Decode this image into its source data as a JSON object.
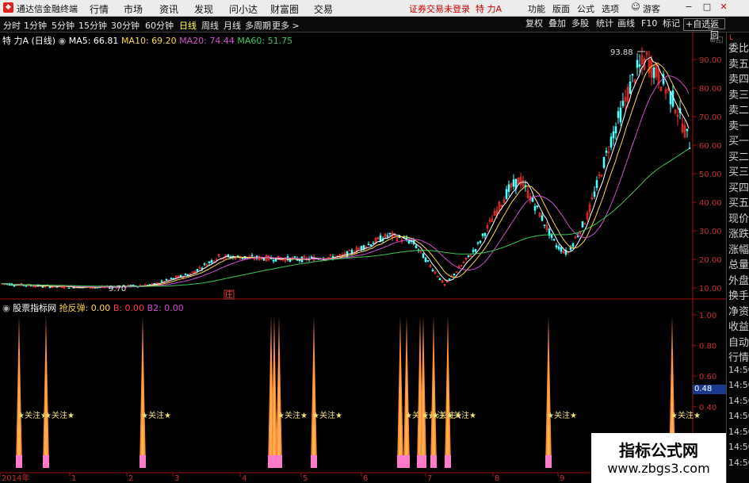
{
  "titlebar": {
    "app_title": "通达信金融终端",
    "menus": [
      "行情",
      "市场",
      "资讯",
      "发现",
      "问小达",
      "财富圈",
      "交易"
    ],
    "notice": "证券交易未登录",
    "stock": "特 力A",
    "right_menus": [
      "功能",
      "版面",
      "公式",
      "选项"
    ],
    "guest": "游客"
  },
  "toolbar": {
    "periods": [
      "分时",
      "1分钟",
      "5分钟",
      "15分钟",
      "30分钟",
      "60分钟",
      "日线",
      "周线",
      "月线",
      "多周期",
      "更多 >"
    ],
    "active_period": "日线",
    "right_buttons": [
      "复权",
      "叠加",
      "多股",
      "统计",
      "画线",
      "F10",
      "标记",
      "+自选",
      "返回"
    ]
  },
  "main_chart": {
    "stock_label": "特 力A (日线)",
    "ma": [
      {
        "label": "MA5: 66.81",
        "color": "#ffffff"
      },
      {
        "label": "MA10: 69.20",
        "color": "#ffd54a"
      },
      {
        "label": "MA20: 74.44",
        "color": "#d050d0"
      },
      {
        "label": "MA60: 51.75",
        "color": "#3cc85a"
      }
    ],
    "high_label": "93.88",
    "low_label": "9.70",
    "event_marker": "庄",
    "y_ticks": [
      "90.00",
      "80.00",
      "70.00",
      "60.00",
      "50.00",
      "40.00",
      "30.00",
      "20.00",
      "10.00"
    ]
  },
  "sub_chart": {
    "title": "股票指标网",
    "indicator": "抢反弹: 0.00",
    "b_label": "B: 0.00",
    "b2_label": "B2: 0.00",
    "y_ticks": [
      "1.00",
      "0.80",
      "0.60",
      "0.40",
      "0.20"
    ],
    "current_value": "0.48",
    "signal_label": "关注",
    "signals": [
      {
        "x": 24,
        "mark": true
      },
      {
        "x": 58,
        "mark": true
      },
      {
        "x": 180,
        "mark": true
      },
      {
        "x": 342,
        "mark": false
      },
      {
        "x": 346,
        "mark": false
      },
      {
        "x": 352,
        "mark": true
      },
      {
        "x": 396,
        "mark": true
      },
      {
        "x": 505,
        "mark": false
      },
      {
        "x": 513,
        "mark": true
      },
      {
        "x": 530,
        "mark": false
      },
      {
        "x": 534,
        "mark": true
      },
      {
        "x": 547,
        "mark": true
      },
      {
        "x": 565,
        "mark": true
      },
      {
        "x": 692,
        "mark": true
      },
      {
        "x": 848,
        "mark": true
      }
    ]
  },
  "time_axis": {
    "labels": [
      "2014年",
      "1",
      "2",
      "3",
      "4",
      "5",
      "6",
      "7",
      "8",
      "9"
    ]
  },
  "right_panel": {
    "top_label": "L",
    "items": [
      "委比",
      "卖五",
      "卖四",
      "卖三",
      "卖二",
      "卖一",
      "买一",
      "买二",
      "买三",
      "买四",
      "买五",
      "现价",
      "涨跌",
      "涨幅",
      "总量",
      "外盘",
      "换手",
      "净资",
      "收益",
      "自动",
      "行情",
      "14:50",
      "14:50",
      "14:50",
      "14:50",
      "14:50",
      "14:50",
      "14:50"
    ]
  },
  "watermark": {
    "line1": "指标公式网",
    "line2": "www.zbgs3.com"
  }
}
